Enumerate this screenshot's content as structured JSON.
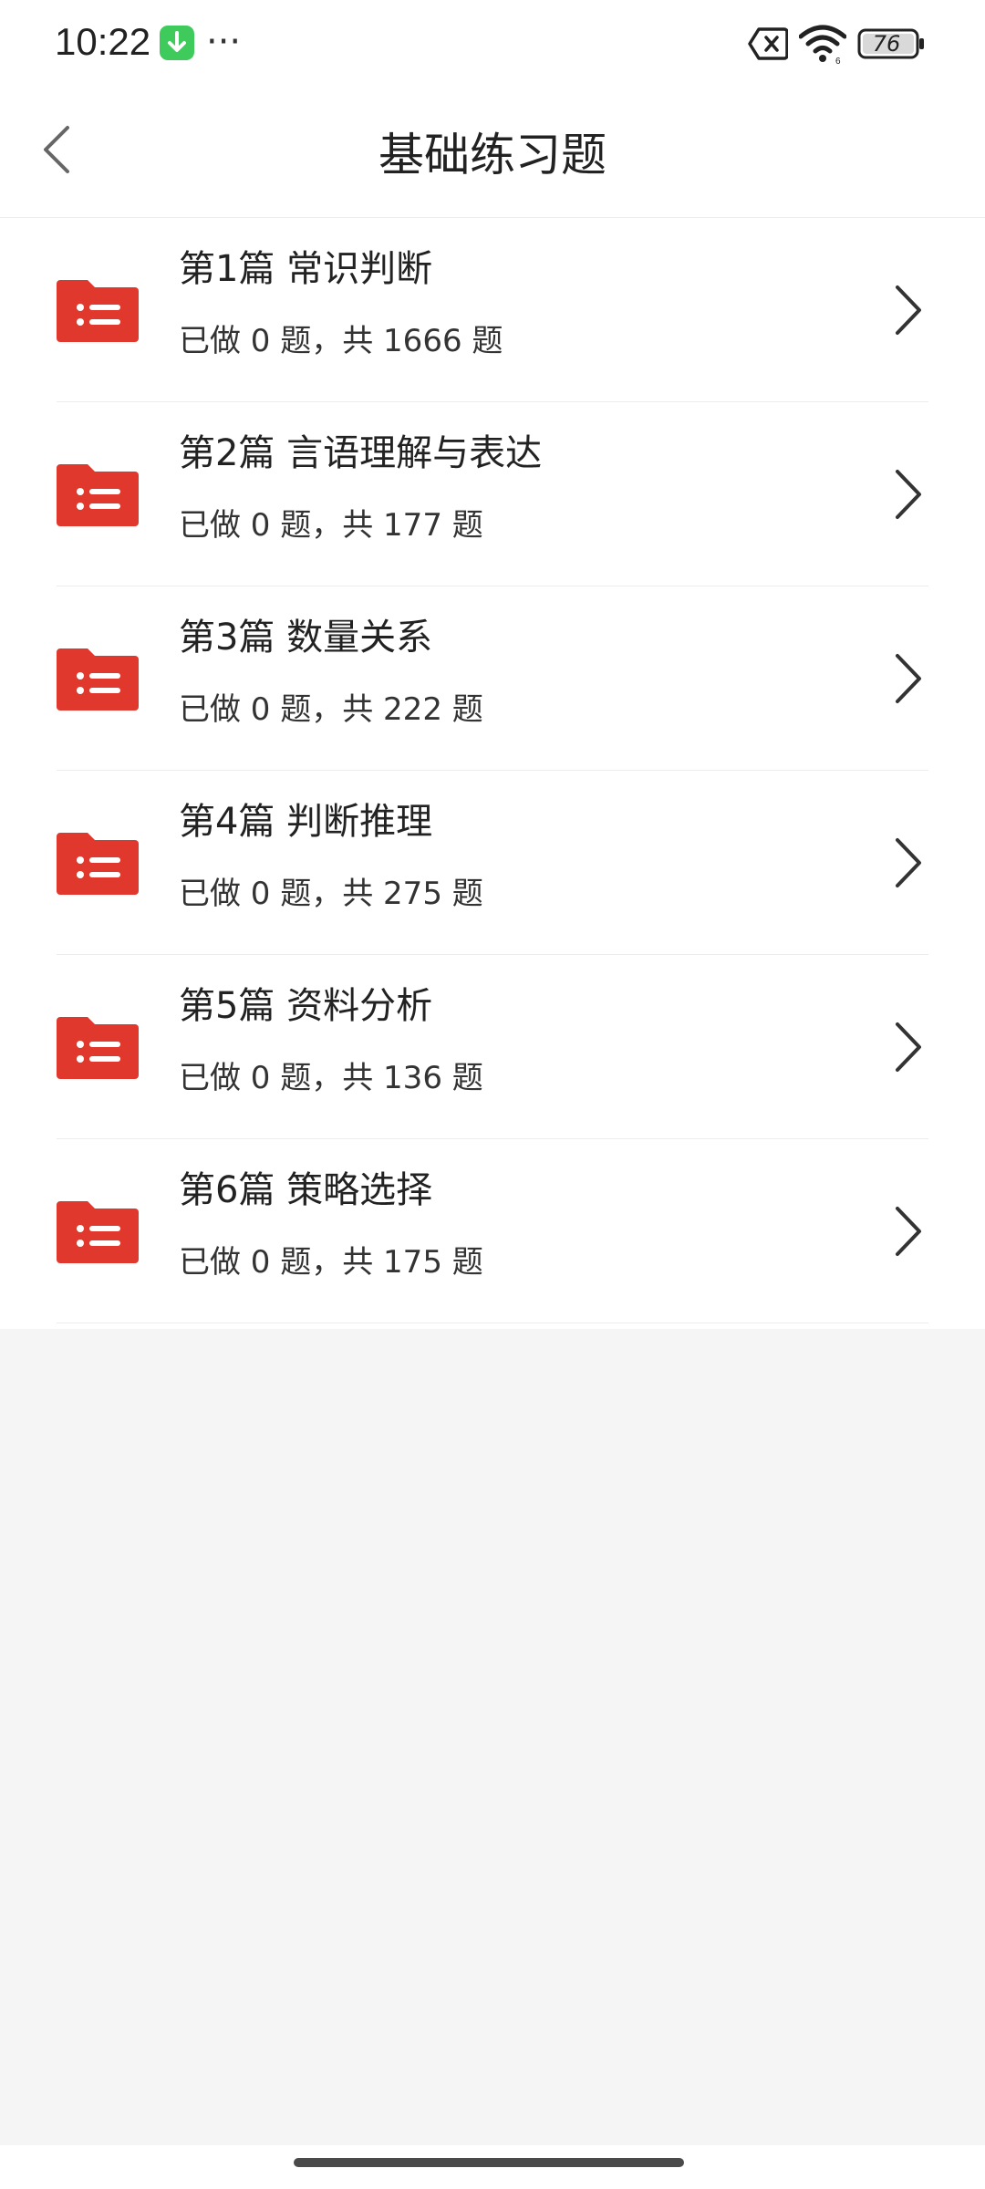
{
  "status_bar": {
    "time": "10:22",
    "more": "···",
    "battery": "76"
  },
  "header": {
    "title": "基础练习题"
  },
  "items": [
    {
      "title": "第1篇 常识判断",
      "subtitle": "已做 0 题，共 1666 题"
    },
    {
      "title": "第2篇 言语理解与表达",
      "subtitle": "已做 0 题，共 177 题"
    },
    {
      "title": "第3篇 数量关系",
      "subtitle": "已做 0 题，共 222 题"
    },
    {
      "title": "第4篇 判断推理",
      "subtitle": "已做 0 题，共 275 题"
    },
    {
      "title": "第5篇 资料分析",
      "subtitle": "已做 0 题，共 136 题"
    },
    {
      "title": "第6篇 策略选择",
      "subtitle": "已做 0 题，共 175 题"
    }
  ],
  "colors": {
    "accent": "#e0382c",
    "download_badge": "#3ecb5b"
  },
  "icons": {
    "back": "chevron-left-icon",
    "item": "folder-list-icon",
    "item_action": "chevron-right-icon"
  }
}
